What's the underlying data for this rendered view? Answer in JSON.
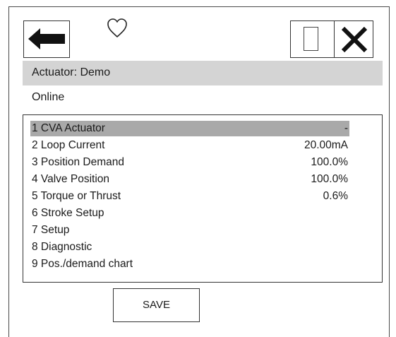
{
  "toolbar": {
    "back_icon": "arrow-left-icon",
    "favorite_icon": "heart-icon",
    "window_icon": "square-icon",
    "close_icon": "close-icon"
  },
  "header": {
    "title": "Actuator: Demo",
    "status": "Online"
  },
  "menu": {
    "items": [
      {
        "label": "1 CVA Actuator",
        "value": "-"
      },
      {
        "label": "2 Loop Current",
        "value": "20.00mA"
      },
      {
        "label": "3 Position Demand",
        "value": "100.0%"
      },
      {
        "label": "4 Valve Position",
        "value": "100.0%"
      },
      {
        "label": "5 Torque or Thrust",
        "value": "0.6%"
      },
      {
        "label": "6 Stroke Setup",
        "value": ""
      },
      {
        "label": "7 Setup",
        "value": ""
      },
      {
        "label": "8 Diagnostic",
        "value": ""
      },
      {
        "label": "9 Pos./demand chart",
        "value": ""
      }
    ]
  },
  "footer": {
    "save_label": "SAVE"
  },
  "colors": {
    "selected_row": "#a9a9a9",
    "title_bar": "#d4d4d4",
    "border": "#333333"
  }
}
